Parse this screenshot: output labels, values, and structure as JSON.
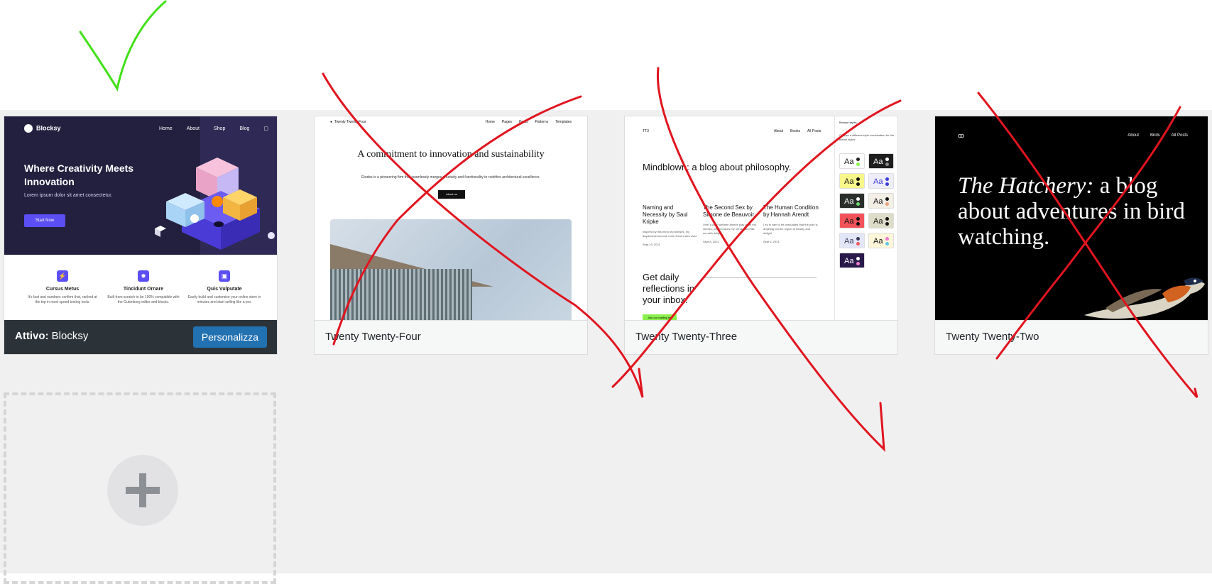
{
  "themes": [
    {
      "name": "Blocksy",
      "active": true,
      "active_prefix": "Attivo:",
      "customize_label": "Personalizza",
      "preview": {
        "logo": "Blocksy",
        "nav": [
          "Home",
          "About",
          "Shop",
          "Blog"
        ],
        "title": "Where Creativity Meets Innovation",
        "subtitle": "Lorem ipsum dolor sit amet consectetur.",
        "cta": "Start Now",
        "features": [
          {
            "title": "Cursus Metus",
            "desc": "It's fast and numbers confirm that, ranked at the top in most speed testing tools."
          },
          {
            "title": "Tincidunt Ornare",
            "desc": "Built from scratch to be 100% compatible with the Gutenberg editor and blocks."
          },
          {
            "title": "Quis Vulputate",
            "desc": "Easily build and customize your online store in minutes and start selling like a pro."
          }
        ]
      }
    },
    {
      "name": "Twenty Twenty-Four",
      "active": false,
      "preview": {
        "site_title": "Twenty Twenty Four",
        "nav": [
          "Home",
          "Pages",
          "Posts",
          "Patterns",
          "Templates"
        ],
        "headline": "A commitment to innovation and sustainability",
        "text": "Études is a pioneering firm that seamlessly merges creativity and functionality to redefine architectural excellence.",
        "button": "About us"
      }
    },
    {
      "name": "Twenty Twenty-Three",
      "active": false,
      "preview": {
        "logo": "TT3",
        "nav": [
          "About",
          "Books",
          "All Posts"
        ],
        "headline": "Mindblown: a blog about philosophy.",
        "posts": [
          {
            "title": "Naming and Necessity by Saul Kripke",
            "excerpt": "Inspired by this mind of promises, my daydreams become more fervent and vivid.",
            "date": "Sept 10, 2021"
          },
          {
            "title": "The Second Sex by Simone de Beauvoir",
            "excerpt": "I feel a cold northern breeze play upon my cheeks, which braces my nerves and fills me with delight.",
            "date": "Sept 8, 2021"
          },
          {
            "title": "The Human Condition by Hannah Arendt",
            "excerpt": "I try in vain to be persuaded that the pole is anything but the region of beauty and delight.",
            "date": "Sept 6, 2021"
          }
        ],
        "subscribe": "Get daily reflections in your inbox.",
        "join": "Join our mailing list",
        "styles_title": "Browse styles",
        "styles_desc": "Choose a different style combination for the theme styles",
        "swatch_label": "Aa",
        "swatches": [
          {
            "bg": "#ffffff",
            "fg": "#111111",
            "a": "#1f1f1f",
            "b": "#8cf04c"
          },
          {
            "bg": "#1e1e1e",
            "fg": "#ffffff",
            "a": "#ffffff",
            "b": "#8a8a8a"
          },
          {
            "bg": "#f8f78a",
            "fg": "#111111",
            "a": "#111111",
            "b": "#111111"
          },
          {
            "bg": "#eeeefa",
            "fg": "#3b3bdb",
            "a": "#3b3bdb",
            "b": "#3b3bdb"
          },
          {
            "bg": "#2b2f2c",
            "fg": "#ffffff",
            "a": "#ffffff",
            "b": "#70d96a"
          },
          {
            "bg": "#f3efe6",
            "fg": "#111111",
            "a": "#111111",
            "b": "#e9a07a"
          },
          {
            "bg": "#f2535a",
            "fg": "#111111",
            "a": "#111111",
            "b": "#111111"
          },
          {
            "bg": "#dcdcc8",
            "fg": "#111111",
            "a": "#111111",
            "b": "#111111"
          },
          {
            "bg": "#e3e6f6",
            "fg": "#3b3b5b",
            "a": "#3b3b5b",
            "b": "#f15a5a"
          },
          {
            "bg": "#fdf6d8",
            "fg": "#111111",
            "a": "#f07ad0",
            "b": "#5dc6f0"
          },
          {
            "bg": "#2a1a4a",
            "fg": "#ffffff",
            "a": "#ffffff",
            "b": "#f07ad0"
          }
        ]
      }
    },
    {
      "name": "Twenty Twenty-Two",
      "active": false,
      "preview": {
        "logo": "ꝏ",
        "nav": [
          "About",
          "Birds",
          "All Posts"
        ],
        "headline_italic": "The Hatchery:",
        "headline_rest": " a blog about adventures in bird watching."
      }
    }
  ],
  "add_new": {
    "icon": "plus-icon"
  },
  "colors": {
    "admin_bg": "#f0f0f1",
    "primary_button": "#2271b1",
    "active_bar": "#2c3338",
    "checkmark": "#42e01a",
    "cross": "#e0151f"
  }
}
